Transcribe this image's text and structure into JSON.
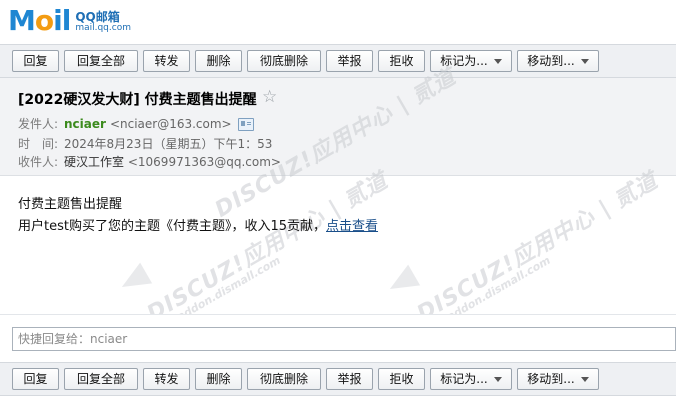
{
  "logo": {
    "mail": [
      "M",
      "o",
      "il"
    ],
    "cn": "QQ邮箱",
    "url": "mail.qq.com"
  },
  "toolbar": {
    "buttons": [
      {
        "label": "回复"
      },
      {
        "label": "回复全部"
      },
      {
        "label": "转发"
      },
      {
        "label": "删除"
      },
      {
        "label": "彻底删除"
      },
      {
        "label": "举报"
      },
      {
        "label": "拒收"
      },
      {
        "label": "标记为..."
      },
      {
        "label": "移动到..."
      }
    ]
  },
  "mail": {
    "subject": "[2022硬汉发大财] 付费主题售出提醒",
    "star": "☆",
    "sender_label": "发件人:",
    "sender_name": "nciaer",
    "sender_email": "<nciaer@163.com>",
    "time_label": "时　间:",
    "time_value": "2024年8月23日（星期五）下午1：53",
    "recipient_label": "收件人:",
    "recipient_name": "硬汉工作室",
    "recipient_email": "<1069971363@qq.com>",
    "body_line1": "付费主题售出提醒",
    "body_line2_text": "用户test购买了您的主题《付费主题》，收入15贡献，",
    "body_link": "点击查看"
  },
  "watermark": {
    "big": "DISCUZ!应用中心 | 贰道",
    "small": "addon.dismall.com"
  },
  "quick_reply": {
    "placeholder": "快捷回复给：nciaer"
  }
}
